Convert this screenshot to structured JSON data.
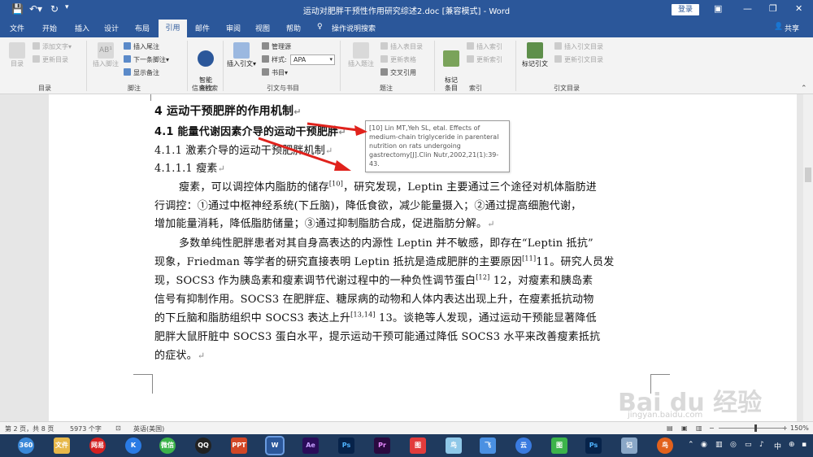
{
  "titlebar": {
    "doc_title": "运动对肥胖干预性作用研究综述2.doc [兼容模式] - Word",
    "login_label": "登录",
    "save_icon": "save-icon",
    "undo_icon": "undo-icon",
    "redo_icon": "redo-icon"
  },
  "menu": {
    "tabs": [
      "文件",
      "开始",
      "插入",
      "设计",
      "布局",
      "引用",
      "邮件",
      "审阅",
      "视图",
      "帮助"
    ],
    "active": "引用",
    "tell_me": "操作说明搜索",
    "share": "共享"
  },
  "ribbon": {
    "toc": {
      "big": "目录",
      "add_text": "添加文字",
      "update_toc": "更新目录",
      "label": "目录"
    },
    "footnote": {
      "big": "插入脚注",
      "insert_endnote": "插入尾注",
      "next_footnote": "下一条脚注",
      "show_notes": "显示备注",
      "label": "脚注"
    },
    "research": {
      "big": "智能\n查找",
      "label": "信息检索"
    },
    "citations": {
      "insert_citation": "插入引文",
      "manage_sources": "管理源",
      "style_label": "样式:",
      "style_value": "APA",
      "bibliography": "书目",
      "label": "引文与书目"
    },
    "captions": {
      "insert_caption": "插入题注",
      "insert_tof": "插入表目录",
      "update_table": "更新表格",
      "cross_ref": "交叉引用",
      "label": "题注"
    },
    "index": {
      "mark_entry": "标记\n条目",
      "insert_index": "插入索引",
      "update_index": "更新索引",
      "label": "索引"
    },
    "toa": {
      "mark_citation": "标记引文",
      "insert_toa": "插入引文目录",
      "update_toa": "更新引文目录",
      "label": "引文目录"
    }
  },
  "document": {
    "h1": "4  运动干预肥胖的作用机制",
    "h2": "4.1  能量代谢因素介导的运动干预肥胖",
    "h3": "4.1.1  激素介导的运动干预肥胖机制",
    "h4": "4.1.1.1  瘦素",
    "p1_l1_a": "瘦素，可以调控体内脂肪的储存",
    "p1_l1_sup": "[10]",
    "p1_l1_b": "，研究发现，Leptin 主要通过三个途径对机体脂肪进",
    "p1_l2": "行调控：①通过中枢神经系统(下丘脑)，降低食欲，减少能量摄入；②通过提高细胞代谢，",
    "p1_l3": "增加能量消耗，降低脂肪储量；③通过抑制脂肪合成，促进脂肪分解。",
    "p2_l1": "多数单纯性肥胖患者对其自身高表达的内源性 Leptin 并不敏感，即存在“Leptin 抵抗”",
    "p2_l2_a": "现象，Friedman 等学者的研究直接表明 Leptin 抵抗是造成肥胖的主要原因",
    "p2_l2_sup": "[11]",
    "p2_l2_b": "11。研究人员发",
    "p2_l3_a": "现，SOCS3 作为胰岛素和瘦素调节代谢过程中的一种负性调节蛋白",
    "p2_l3_sup": "[12]",
    "p2_l3_b": " 12，对瘦素和胰岛素",
    "p2_l4": "信号有抑制作用。SOCS3 在肥胖症、糖尿病的动物和人体内表达出现上升，在瘦素抵抗动物",
    "p2_l5_a": "的下丘脑和脂肪组织中 SOCS3 表达上升",
    "p2_l5_sup": "[13,14]",
    "p2_l5_b": " 13。谈艳等人发现，通过运动干预能显著降低",
    "p2_l6": "肥胖大鼠肝脏中 SOCS3 蛋白水平，提示运动干预可能通过降低 SOCS3 水平来改善瘦素抵抗",
    "p2_l7": "的症状。"
  },
  "tooltip": {
    "text": "[10] Lin MT,Yeh SL, etal. Effects of medium-chain triglyceride in parenteral nutrition on rats undergoing gastrectomy[J].Clin Nutr,2002,21(1):39-43."
  },
  "statusbar": {
    "page": "第 2 页，共 8 页",
    "words": "5973 个字",
    "lang": "英语(美国)",
    "zoom": "150%"
  },
  "watermark": {
    "main": "Bai du 经验",
    "sub": "jingyan.baidu.com"
  },
  "taskbar": {
    "apps": [
      "360",
      "文件",
      "网易",
      "K",
      "微信",
      "QQ",
      "PPT",
      "W",
      "Ae",
      "Ps",
      "Pr",
      "图",
      "鸟",
      "飞",
      "云",
      "图",
      "Ps",
      "记",
      "鸟"
    ],
    "tray_ime": "中"
  },
  "colors": {
    "word_blue": "#2b579a",
    "arrow_red": "#e0221c"
  }
}
